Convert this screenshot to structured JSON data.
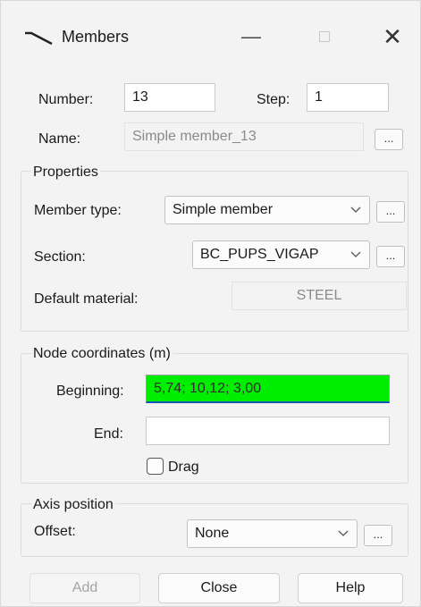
{
  "window": {
    "title": "Members",
    "minimize": "—",
    "close": "✕"
  },
  "number": {
    "label": "Number:",
    "value": "13"
  },
  "step": {
    "label": "Step:",
    "value": "1"
  },
  "name": {
    "label": "Name:",
    "value": "Simple member_13",
    "browse": "..."
  },
  "properties": {
    "title": "Properties",
    "member_type": {
      "label": "Member type:",
      "value": "Simple member",
      "browse": "..."
    },
    "section": {
      "label": "Section:",
      "value": "BC_PUPS_VIGAP",
      "browse": "..."
    },
    "default_material": {
      "label": "Default material:",
      "value": "STEEL"
    }
  },
  "node_coordinates": {
    "title": "Node coordinates (m)",
    "beginning": {
      "label": "Beginning:",
      "value": "5,74; 10,12; 3,00"
    },
    "end": {
      "label": "End:",
      "value": ""
    },
    "drag": {
      "label": "Drag",
      "checked": false
    }
  },
  "axis_position": {
    "title": "Axis position",
    "offset": {
      "label": "Offset:",
      "value": "None",
      "browse": "..."
    }
  },
  "buttons": {
    "add": "Add",
    "close": "Close",
    "help": "Help"
  },
  "colors": {
    "highlight": "#00ee00",
    "focus_underline": "#1a56b0",
    "window_bg": "#f3f3f3"
  }
}
